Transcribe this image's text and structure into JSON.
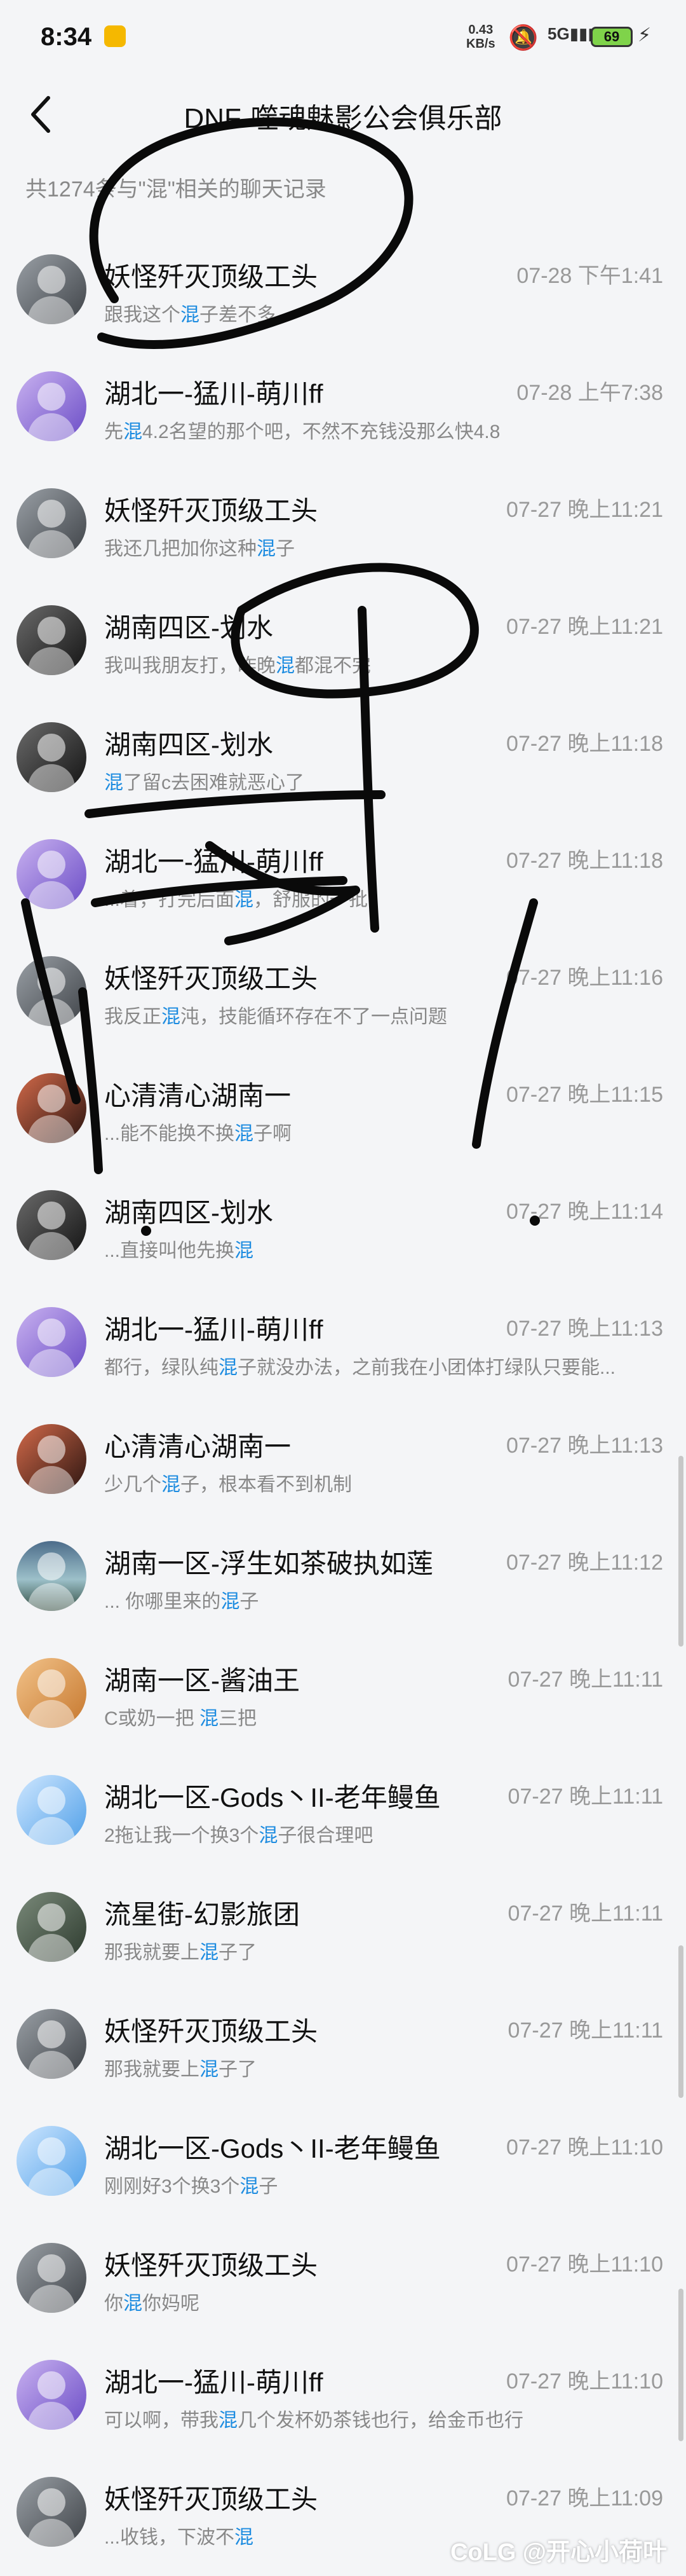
{
  "status_bar": {
    "time": "8:34",
    "speed_value": "0.43",
    "speed_unit": "KB/s",
    "network": "5G",
    "battery": "69"
  },
  "nav": {
    "title": "DNF-噬魂魅影公会俱乐部"
  },
  "search": {
    "result_summary": "共1274条与\"混\"相关的聊天记录"
  },
  "keyword": "混",
  "messages": [
    {
      "name": "妖怪歼灭顶级工头",
      "time": "07-28 下午1:41",
      "pre": "跟我这个",
      "kw": "混",
      "post": "子差不多",
      "avatar": "av-gray"
    },
    {
      "name": "湖北一-猛川-萌川ff",
      "time": "07-28 上午7:38",
      "pre": "先",
      "kw": "混",
      "post": "4.2名望的那个吧，不然不充钱没那么快4.8",
      "avatar": "av-purple"
    },
    {
      "name": "妖怪歼灭顶级工头",
      "time": "07-27 晚上11:21",
      "pre": "我还几把加你这种",
      "kw": "混",
      "post": "子",
      "avatar": "av-gray"
    },
    {
      "name": "湖南四区-划水",
      "time": "07-27 晚上11:21",
      "pre": "我叫我朋友打，昨晚",
      "kw": "混",
      "post": "都混不完",
      "avatar": "av-dark"
    },
    {
      "name": "湖南四区-划水",
      "time": "07-27 晚上11:18",
      "pre": "",
      "kw": "混",
      "post": "了留c去困难就恶心了",
      "avatar": "av-dark"
    },
    {
      "name": "湖北一-猛川-萌川ff",
      "time": "07-27 晚上11:18",
      "pre": "...着，打完后面",
      "kw": "混",
      "post": "，舒服的一批",
      "avatar": "av-purple"
    },
    {
      "name": "妖怪歼灭顶级工头",
      "time": "07-27 晚上11:16",
      "pre": "我反正",
      "kw": "混",
      "post": "沌，技能循环存在不了一点问题",
      "avatar": "av-gray"
    },
    {
      "name": "心清清心湖南一",
      "time": "07-27 晚上11:15",
      "pre": "...能不能换不换",
      "kw": "混",
      "post": "子啊",
      "avatar": "av-red"
    },
    {
      "name": "湖南四区-划水",
      "time": "07-27 晚上11:14",
      "pre": "...直接叫他先换",
      "kw": "混",
      "post": "",
      "avatar": "av-dark"
    },
    {
      "name": "湖北一-猛川-萌川ff",
      "time": "07-27 晚上11:13",
      "pre": "都行，绿队纯",
      "kw": "混",
      "post": "子就没办法，之前我在小团体打绿队只要能...",
      "avatar": "av-purple"
    },
    {
      "name": "心清清心湖南一",
      "time": "07-27 晚上11:13",
      "pre": "少几个",
      "kw": "混",
      "post": "子，根本看不到机制",
      "avatar": "av-red"
    },
    {
      "name": "湖南一区-浮生如茶破执如莲",
      "time": "07-27 晚上11:12",
      "pre": "... 你哪里来的",
      "kw": "混",
      "post": "子",
      "avatar": "av-landscape"
    },
    {
      "name": "湖南一区-酱油王",
      "time": "07-27 晚上11:11",
      "pre": "C或奶一把 ",
      "kw": "混",
      "post": "三把",
      "avatar": "av-orange"
    },
    {
      "name": "湖北一区-Gods丶II-老年鳗鱼",
      "time": "07-27 晚上11:11",
      "pre": "2拖让我一个换3个",
      "kw": "混",
      "post": "子很合理吧",
      "avatar": "av-blue"
    },
    {
      "name": "流星街-幻影旅团",
      "time": "07-27 晚上11:11",
      "pre": "那我就要上",
      "kw": "混",
      "post": "子了",
      "avatar": "av-cat"
    },
    {
      "name": "妖怪歼灭顶级工头",
      "time": "07-27 晚上11:11",
      "pre": "那我就要上",
      "kw": "混",
      "post": "子了",
      "avatar": "av-gray"
    },
    {
      "name": "湖北一区-Gods丶II-老年鳗鱼",
      "time": "07-27 晚上11:10",
      "pre": "刚刚好3个换3个",
      "kw": "混",
      "post": "子",
      "avatar": "av-blue"
    },
    {
      "name": "妖怪歼灭顶级工头",
      "time": "07-27 晚上11:10",
      "pre": "你",
      "kw": "混",
      "post": "你妈呢",
      "avatar": "av-gray"
    },
    {
      "name": "湖北一-猛川-萌川ff",
      "time": "07-27 晚上11:10",
      "pre": "可以啊，带我",
      "kw": "混",
      "post": "几个发杯奶茶钱也行，给金币也行",
      "avatar": "av-purple"
    },
    {
      "name": "妖怪歼灭顶级工头",
      "time": "07-27 晚上11:09",
      "pre": "...收钱，下波不",
      "kw": "混",
      "post": "",
      "avatar": "av-gray"
    }
  ],
  "watermark": "CoLG @开心小荷叶"
}
